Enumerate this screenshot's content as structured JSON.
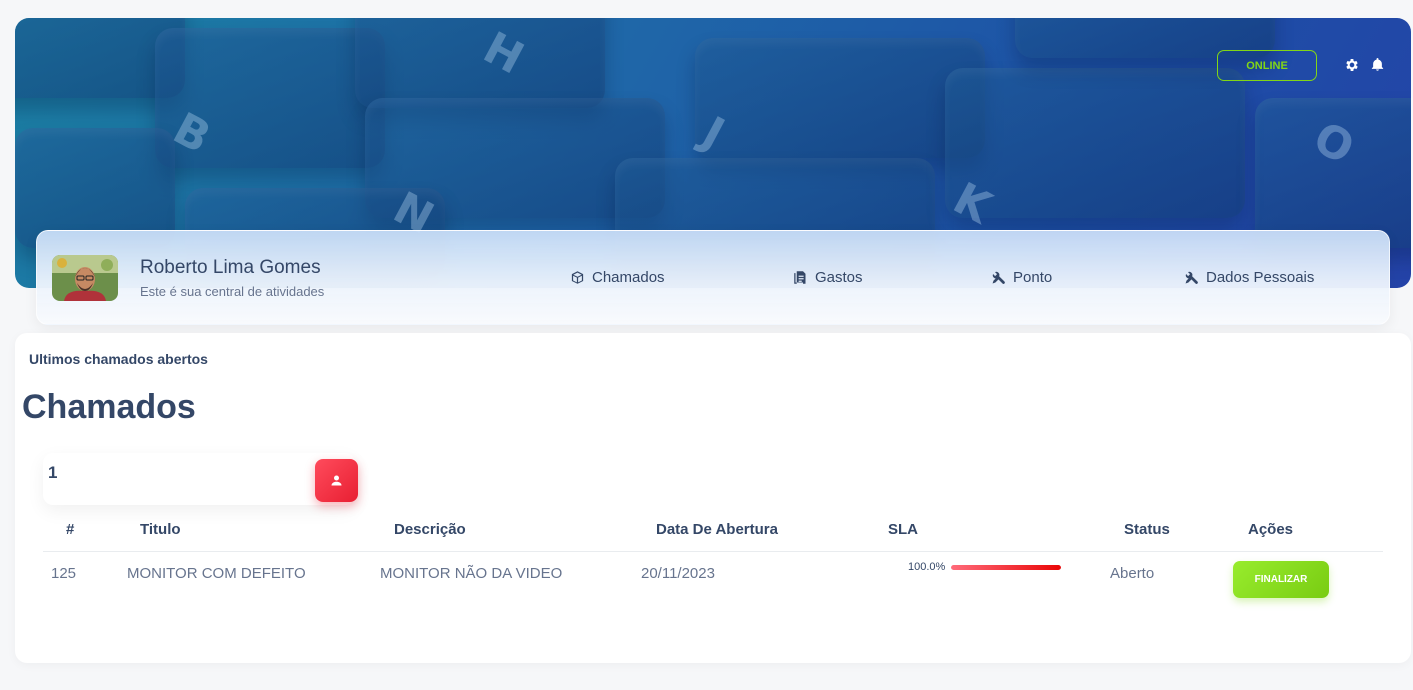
{
  "header": {
    "status_button": "ONLINE",
    "accent_color": "#82d616",
    "icons": [
      "gear-icon",
      "bell-icon"
    ],
    "banner_glyphs": [
      "B",
      "N",
      "H",
      "J",
      "K",
      "O"
    ]
  },
  "profile": {
    "name": "Roberto Lima Gomes",
    "subtitle": "Este é sua central de atividades"
  },
  "nav": [
    {
      "label": "Chamados",
      "icon": "cube-icon"
    },
    {
      "label": "Gastos",
      "icon": "document-icon"
    },
    {
      "label": "Ponto",
      "icon": "tools-icon"
    },
    {
      "label": "Dados Pessoais",
      "icon": "tools-icon"
    }
  ],
  "main": {
    "section_label": "Ultimos chamados abertos",
    "title": "Chamados",
    "counter": {
      "value": "1",
      "icon": "user-icon",
      "color": "#ea0606"
    },
    "table": {
      "headers": [
        "#",
        "Titulo",
        "Descrição",
        "Data De Abertura",
        "SLA",
        "Status",
        "Ações"
      ],
      "rows": [
        {
          "id": "125",
          "titulo": "MONITOR COM DEFEITO",
          "descricao": "MONITOR NÃO DA VIDEO",
          "data": "20/11/2023",
          "sla_label": "100.0%",
          "sla_value": 100,
          "status": "Aberto",
          "action": "FINALIZAR"
        }
      ]
    }
  }
}
